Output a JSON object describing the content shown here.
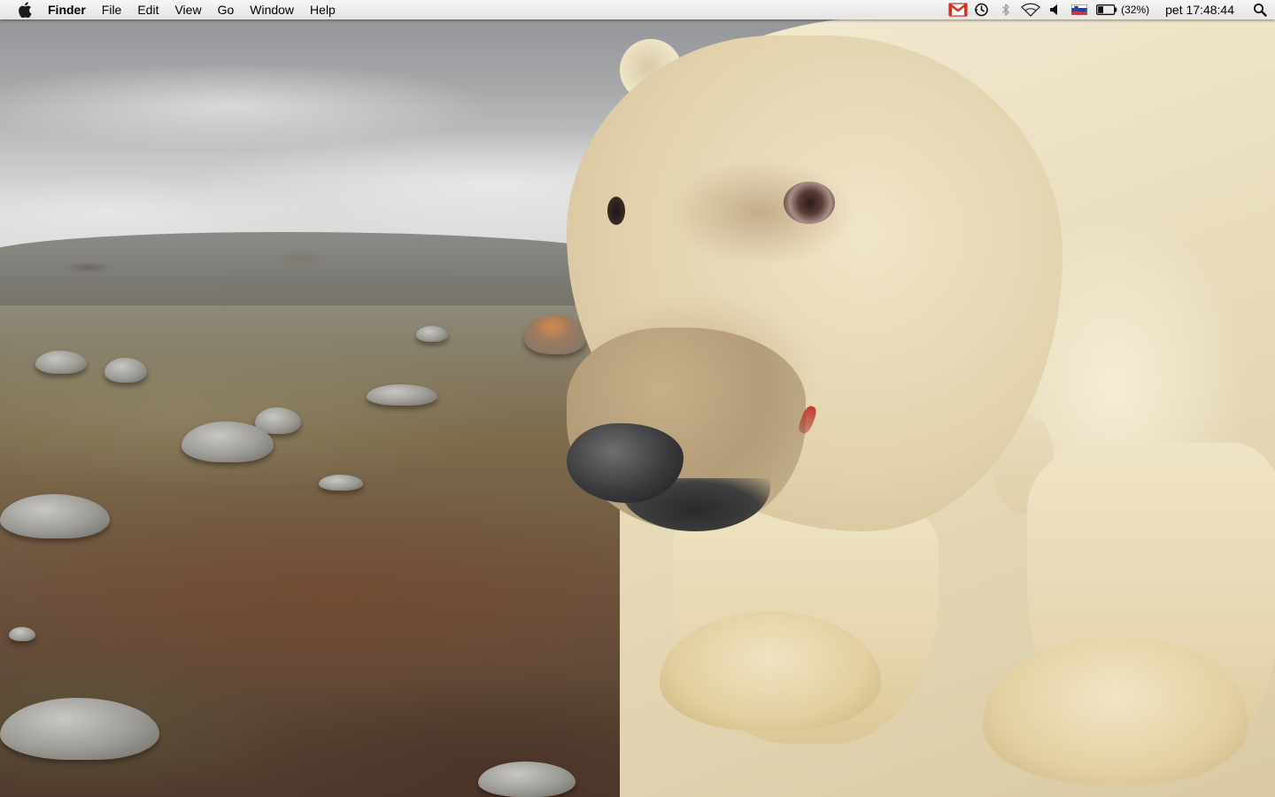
{
  "desktop": {
    "wallpaper": "polar bear on tundra"
  },
  "menubar": {
    "apple_icon": "apple-logo-icon",
    "app_name": "Finder",
    "menus": [
      "File",
      "Edit",
      "View",
      "Go",
      "Window",
      "Help"
    ],
    "status_items": {
      "mail_icon": "gmail-icon",
      "timemachine_icon": "time-machine-icon",
      "bluetooth_icon": "bluetooth-icon",
      "wifi_icon": "wifi-icon",
      "volume_icon": "volume-icon",
      "input_flag_icon": "slovenian-flag-icon",
      "battery_icon": "battery-icon",
      "battery_percent": "(32%)",
      "clock": "pet 17:48:44",
      "spotlight_icon": "spotlight-search-icon"
    },
    "colors": {
      "gmail_red": "#d93025",
      "flag_white": "#ffffff",
      "flag_blue": "#1e3fa8",
      "flag_red": "#e32b2b"
    }
  }
}
